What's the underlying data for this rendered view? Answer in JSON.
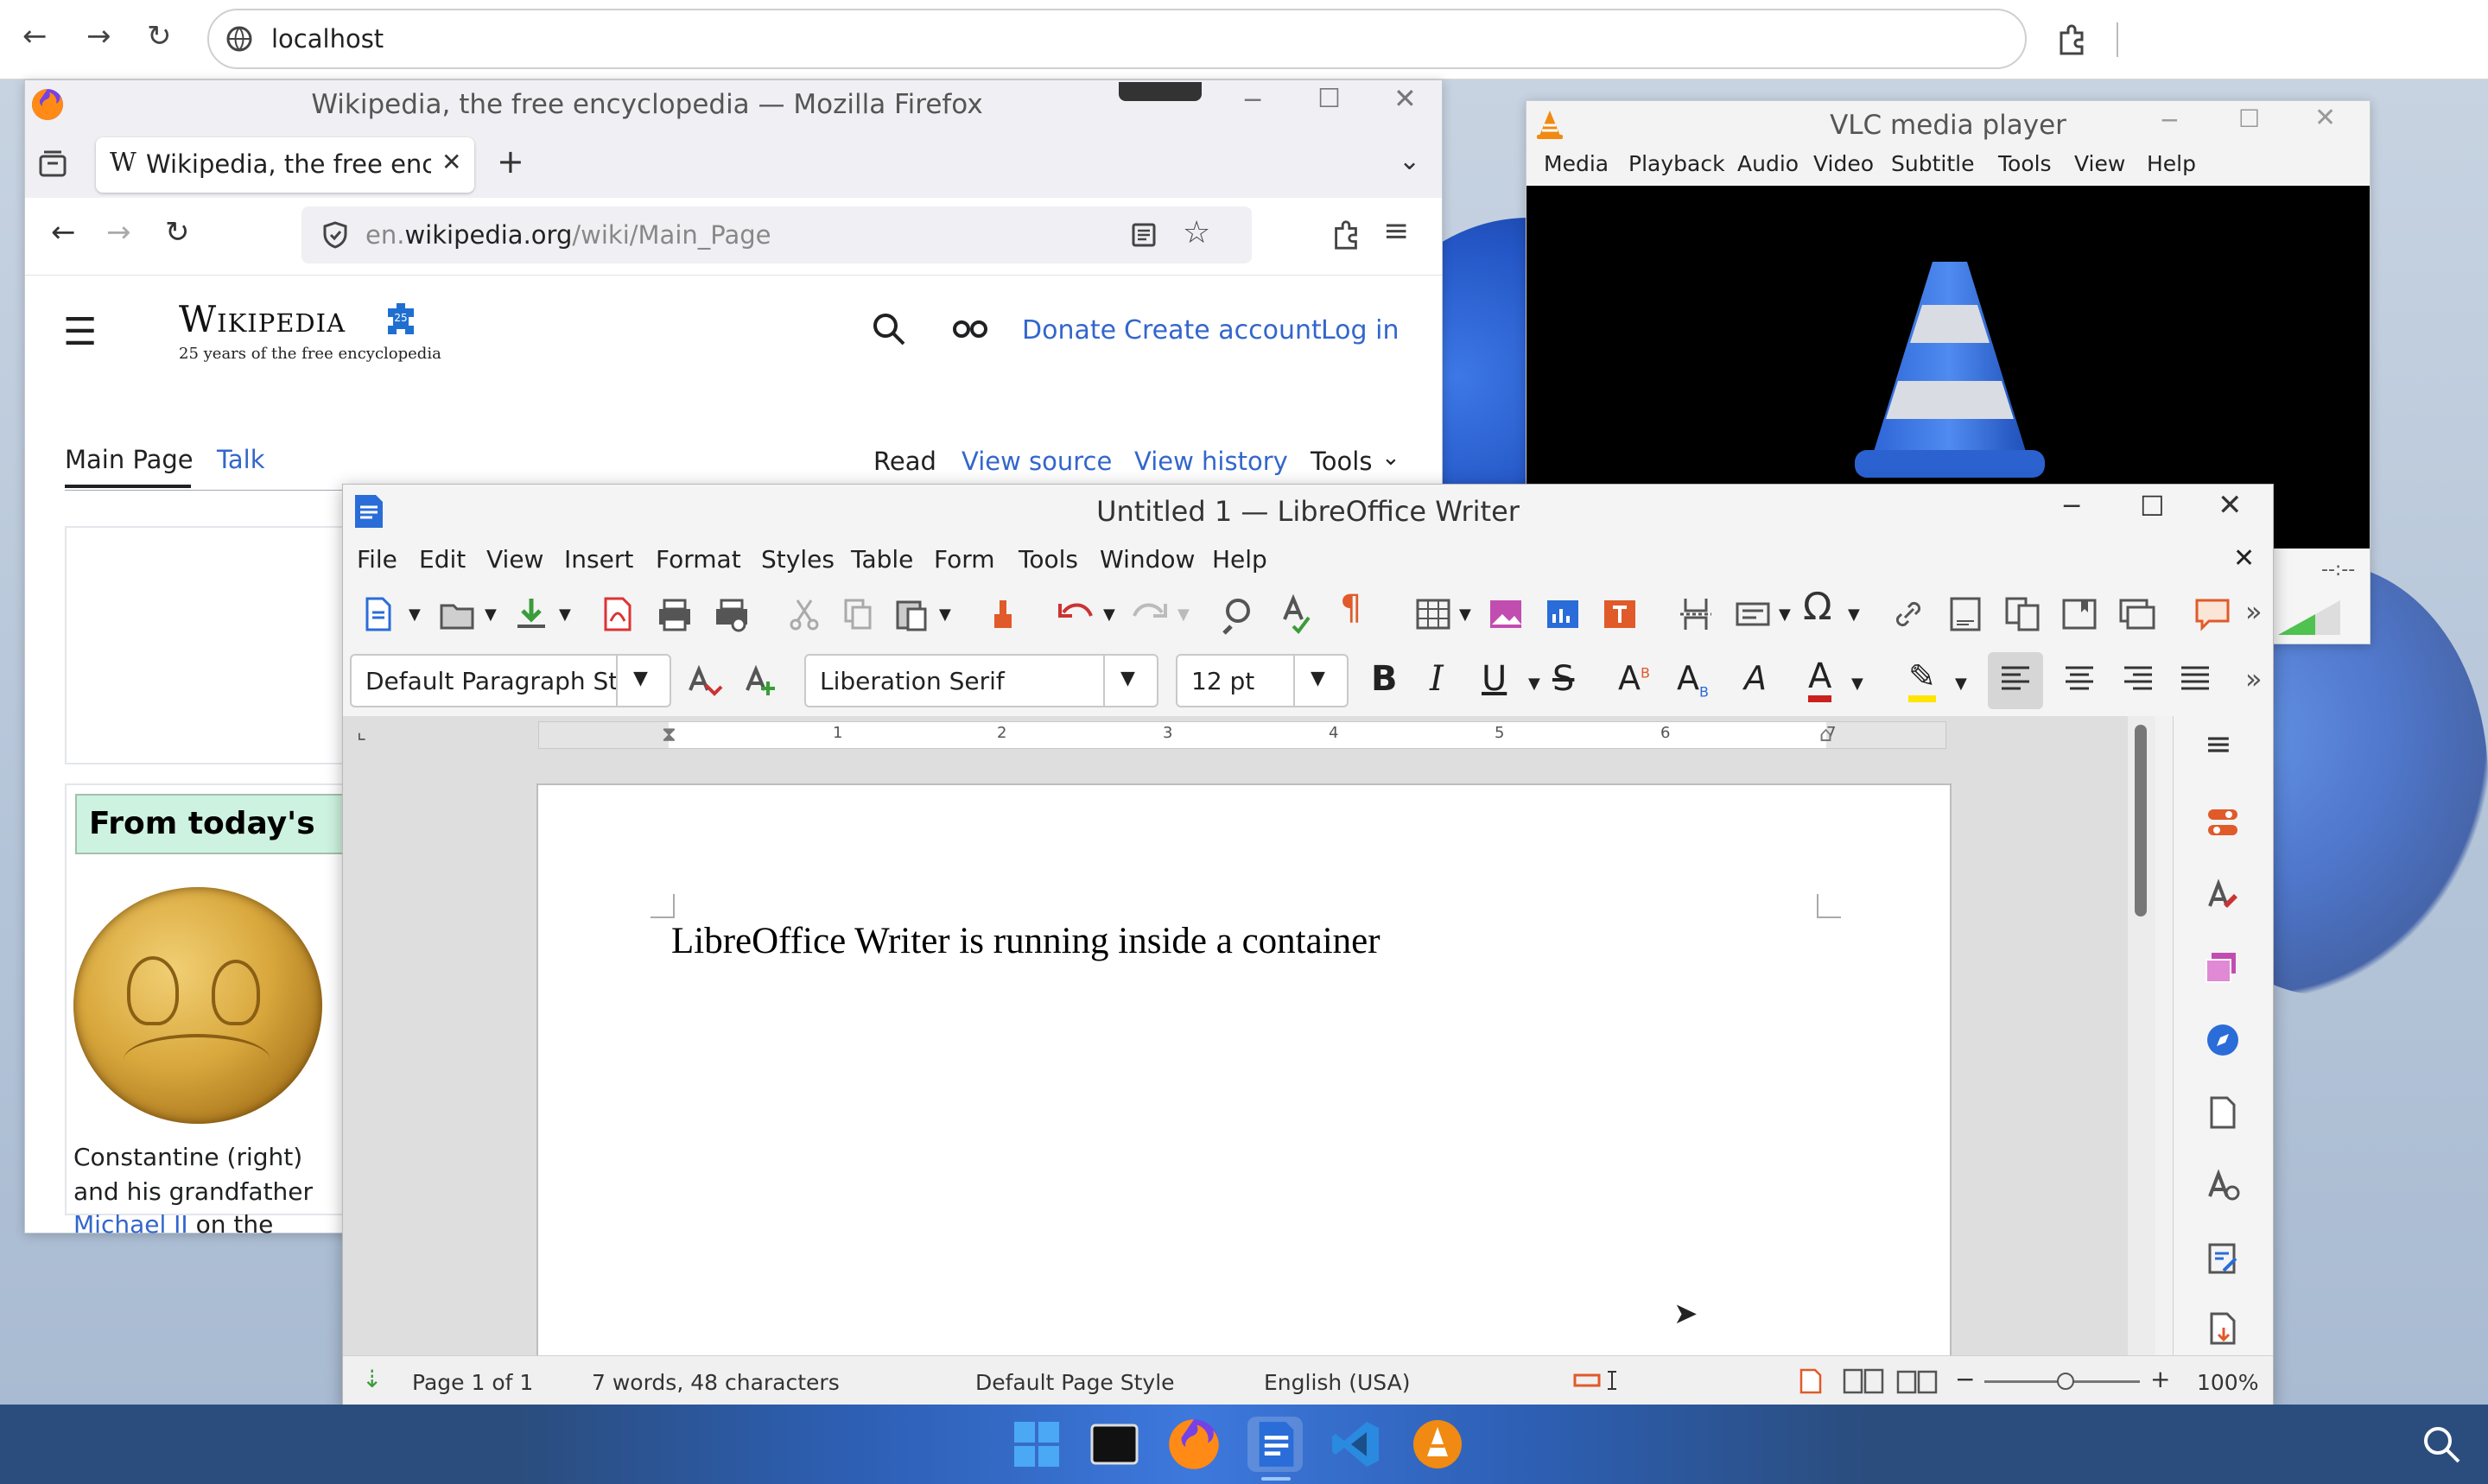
{
  "outer": {
    "url": "localhost"
  },
  "firefox": {
    "window_title": "Wikipedia, the free encyclopedia — Mozilla Firefox",
    "tab_label": "Wikipedia, the free encyclopedia",
    "url_domain_prefix": "en.",
    "url_domain": "wikipedia.org",
    "url_path": "/wiki/Main_Page",
    "logo_text": "Wikipedia",
    "logo_tagline": "25 years of the free encyclopedia",
    "header_links": {
      "donate": "Donate",
      "create_account": "Create account",
      "log_in": "Log in"
    },
    "tabs": {
      "main_page": "Main Page",
      "talk": "Talk"
    },
    "actions": {
      "read": "Read",
      "view_source": "View source",
      "view_history": "View history",
      "tools": "Tools"
    },
    "featured_heading": "From today's",
    "caption_line1": "Constantine (right)",
    "caption_line2": "and his grandfather",
    "caption_link": "Michael II",
    "caption_line3_rest": " on the"
  },
  "vlc": {
    "title": "VLC media player",
    "menu": [
      "Media",
      "Playback",
      "Audio",
      "Video",
      "Subtitle",
      "Tools",
      "View",
      "Help"
    ],
    "time": "--:--"
  },
  "writer": {
    "title": "Untitled 1 — LibreOffice Writer",
    "menu": [
      "File",
      "Edit",
      "View",
      "Insert",
      "Format",
      "Styles",
      "Table",
      "Form",
      "Tools",
      "Window",
      "Help"
    ],
    "paragraph_style": "Default Paragraph Styl",
    "font_name": "Liberation Serif",
    "font_size": "12 pt",
    "ruler_numbers": [
      "1",
      "2",
      "3",
      "4",
      "5",
      "6",
      "7"
    ],
    "document_text": "LibreOffice Writer is running inside a container",
    "status": {
      "page": "Page 1 of 1",
      "words": "7 words, 48 characters",
      "page_style": "Default Page Style",
      "language": "English (USA)",
      "zoom": "100%"
    }
  },
  "colors": {
    "wiki_link": "#3366cc",
    "lo_accent": "#2a6cd8",
    "taskbar": "#2b4d7e"
  }
}
